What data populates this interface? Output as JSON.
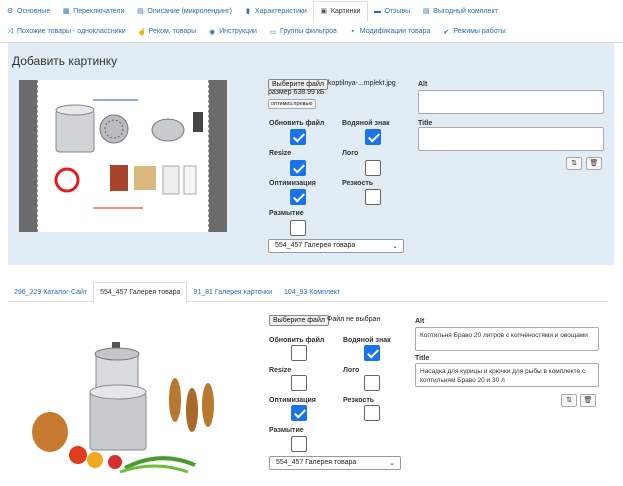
{
  "tabs_row1": [
    {
      "icon": "gear-icon",
      "glyph": "⚙",
      "label": "Основные",
      "active": false
    },
    {
      "icon": "switch-icon",
      "glyph": "▦",
      "label": "Переключатели",
      "active": false
    },
    {
      "icon": "document-icon",
      "glyph": "▤",
      "label": "Описание (микролендинг)",
      "active": false
    },
    {
      "icon": "chart-icon",
      "glyph": "▮",
      "label": "Характеристики",
      "active": false
    },
    {
      "icon": "image-icon",
      "glyph": "▣",
      "label": "Картинки",
      "active": true
    },
    {
      "icon": "comment-icon",
      "glyph": "▬",
      "label": "Отзывы",
      "active": false
    },
    {
      "icon": "list-icon",
      "glyph": "▤",
      "label": "Выгодный комплект",
      "active": false
    }
  ],
  "tabs_row2": [
    {
      "icon": "shuffle-icon",
      "glyph": "⤨",
      "label": "Похожие товары - одноклассники"
    },
    {
      "icon": "thumbs-up-icon",
      "glyph": "☝",
      "label": "Реком. товары"
    },
    {
      "icon": "info-icon",
      "glyph": "◉",
      "label": "Инструкции"
    },
    {
      "icon": "truck-icon",
      "glyph": "▭",
      "label": "Группы фильтров"
    },
    {
      "icon": "cube-icon",
      "glyph": "▪",
      "label": "Модификации товара"
    },
    {
      "icon": "check-icon",
      "glyph": "✔",
      "label": "Режимы работы"
    }
  ],
  "add_image": {
    "title": "Добавить картинку",
    "file_button": "Выберите файл",
    "file_name": "koptilnya-...mplekt.jpg",
    "size": "размер 638.99 кБ",
    "optimize_preview_button": "оптимиз.превью",
    "options": {
      "update_file": {
        "label": "Обновить файл",
        "checked": true
      },
      "watermark": {
        "label": "Водяной знак",
        "checked": true
      },
      "resize": {
        "label": "Resize",
        "checked": true
      },
      "logo": {
        "label": "Лого",
        "checked": false
      },
      "optimization": {
        "label": "Оптимизация",
        "checked": true
      },
      "sharpness": {
        "label": "Резкость",
        "checked": false
      },
      "blur": {
        "label": "Размытие",
        "checked": false
      }
    },
    "gallery_select": "554_457 Галерея товара",
    "alt_label": "Alt",
    "alt_value": "",
    "title_label": "Title",
    "title_value": ""
  },
  "gallery_tabs": [
    {
      "label": "296_229 Каталог-Сайт",
      "active": false
    },
    {
      "label": "554_457 Галерея товара",
      "active": true
    },
    {
      "label": "91_81 Галерея карточки",
      "active": false
    },
    {
      "label": "104_93 Комплект",
      "active": false
    }
  ],
  "gallery_item": {
    "file_button": "Выберите файл",
    "file_status": "Файл не выбран",
    "options": {
      "update_file": {
        "label": "Обновить файл",
        "checked": false
      },
      "watermark": {
        "label": "Водяной знак",
        "checked": true
      },
      "resize": {
        "label": "Resize",
        "checked": false
      },
      "logo": {
        "label": "Лого",
        "checked": false
      },
      "optimization": {
        "label": "Оптимизация",
        "checked": true
      },
      "sharpness": {
        "label": "Резкость",
        "checked": false
      },
      "blur": {
        "label": "Размытие",
        "checked": false
      }
    },
    "gallery_select": "554_457 Галерея товара",
    "alt_label": "Alt",
    "alt_value": "Коптильня Браво 20 литров с копчёностями и овощами",
    "title_label": "Title",
    "title_value": "Насадка для курицы и крючки для рыбы в комплекте с коптильням Браво 20 и 30 л"
  }
}
